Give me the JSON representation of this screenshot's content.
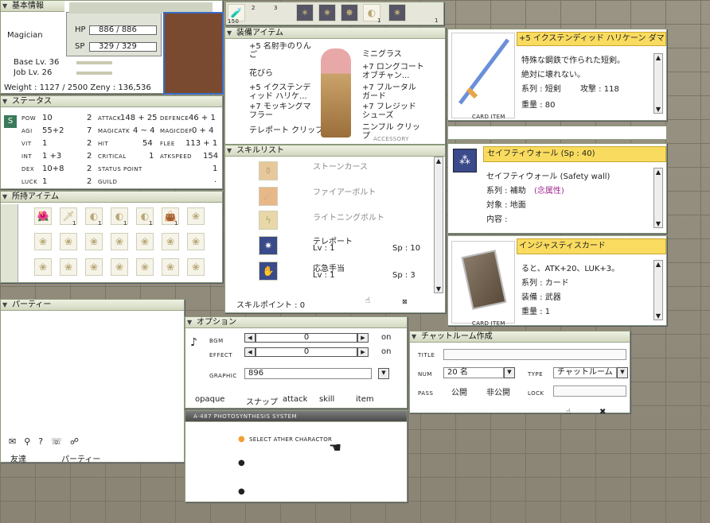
{
  "basic": {
    "title": "基本情報",
    "job": "Magician",
    "base_lv": "Base Lv. 36",
    "job_lv": "Job Lv. 26",
    "weight": "Weight : 1127 / 2500 Zeny : 136,536",
    "hp_label": "HP",
    "hp": "886 / 886",
    "sp_label": "SP",
    "sp": "329 / 329",
    "hp_ratio": 1,
    "sp_ratio": 1
  },
  "quickbar": {
    "slots": [
      "1",
      "2",
      "3",
      "4",
      "5",
      "6",
      "7",
      "8",
      "9"
    ],
    "potion_count": "150",
    "count_7": "1",
    "count_9": "1"
  },
  "equip": {
    "title": "装備アイテム",
    "left": [
      "+5 名射手のりんご",
      "花びら",
      "+5 イクステンディッド ハリケ...",
      "+7 モッキングマフラー",
      "テレポート クリップ"
    ],
    "right": [
      "ミニグラス",
      "+7 ロングコート オブチャン...",
      "+7 ブルータル ガード",
      "+7 フレジッド シューズ",
      "ニンブル クリップ"
    ],
    "accessory_tag": "ACCESSORY"
  },
  "item_detail": {
    "title": "+5 イクステンディッド ハリケーン ダマ",
    "desc1": "特殊な鋼鉄で作られた短剣。",
    "desc2": "絶対に壊れない。",
    "type": "系列 : 短剣",
    "atk": "攻撃 : 118",
    "weight": "重量 : 80",
    "card_item": "CARD ITEM"
  },
  "safety": {
    "title": "セイフティウォール (Sp : 40)",
    "name": "セイフティウォール (Safety wall)",
    "type": "系列 : 補助",
    "prop": "(念属性)",
    "target": "対象 : 地面",
    "content": "内容 :"
  },
  "card": {
    "title": "インジャスティスカード",
    "desc": "ると、ATK+20、LUK+3。",
    "type": "系列 : カード",
    "equip": "装備 : 武器",
    "weight": "重量 : 1",
    "card_item": "CARD ITEM"
  },
  "status": {
    "title": "ステータス",
    "stats": [
      {
        "n": "POW",
        "v": "10",
        "p": "2"
      },
      {
        "n": "AGI",
        "v": "55+2",
        "p": "7"
      },
      {
        "n": "VIT",
        "v": "1",
        "p": "2"
      },
      {
        "n": "INT",
        "v": "1 +3",
        "p": "2"
      },
      {
        "n": "DEX",
        "v": "10+8",
        "p": "2"
      },
      {
        "n": "LUCK",
        "v": "1",
        "p": "2"
      }
    ],
    "mid": [
      {
        "n": "ATTACK",
        "v": "148 + 25"
      },
      {
        "n": "MAGICATK",
        "v": "4 ~ 4"
      },
      {
        "n": "HIT",
        "v": "54"
      },
      {
        "n": "CRITICAL",
        "v": "1"
      },
      {
        "n": "STATUS POINT",
        "v": ""
      },
      {
        "n": "GUILD",
        "v": ""
      }
    ],
    "right": [
      {
        "n": "DEFENCE",
        "v": "46 + 1"
      },
      {
        "n": "MAGICDEF",
        "v": "0 + 4"
      },
      {
        "n": "FLEE",
        "v": "113 + 1"
      },
      {
        "n": "ATKSPEED",
        "v": "154"
      },
      {
        "n": "",
        "v": "1"
      },
      {
        "n": "",
        "v": "."
      }
    ]
  },
  "skills": {
    "title": "スキルリスト",
    "items": [
      {
        "name": "ストーンカース",
        "lv": "",
        "sp": ""
      },
      {
        "name": "ファイアーボルト",
        "lv": "",
        "sp": ""
      },
      {
        "name": "ライトニングボルト",
        "lv": "",
        "sp": ""
      },
      {
        "name": "テレポート",
        "lv": "Lv : 1",
        "sp": "Sp : 10"
      },
      {
        "name": "応急手当",
        "lv": "Lv : 1",
        "sp": "Sp : 3"
      }
    ],
    "points": "スキルポイント : 0"
  },
  "inventory": {
    "title": "所持アイテム",
    "counts": [
      "",
      "1",
      "1",
      "1",
      "1",
      "1"
    ]
  },
  "party": {
    "title": "パーティー",
    "friend": "友達",
    "party": "パーティー"
  },
  "option": {
    "title": "オプション",
    "bgm": "BGM",
    "effect": "EFFECT",
    "graphic": "GRAPHIC",
    "bgm_val": "0",
    "effect_val": "0",
    "on1": "on",
    "on2": "on",
    "graphic_val": "896",
    "opaque": "opaque",
    "snap": "スナップ",
    "attack": "attack",
    "skill": "skill",
    "item": "item"
  },
  "photo": {
    "title": "A-487 PHOTOSYNTHESIS SYSTEM",
    "select": "SELECT ATHER CHARACTOR"
  },
  "chat": {
    "title": "チャットルーム作成",
    "title_lbl": "TITLE",
    "num_lbl": "NUM",
    "num": "20 名",
    "type_lbl": "TYPE",
    "type": "チャットルーム",
    "pass_lbl": "PASS",
    "public": "公開",
    "private": "非公開",
    "lock_lbl": "LOCK"
  },
  "colors": {
    "accent": "#f9db5f",
    "frame": "#8a9a7a",
    "title_bar": "#dfe4cf"
  }
}
